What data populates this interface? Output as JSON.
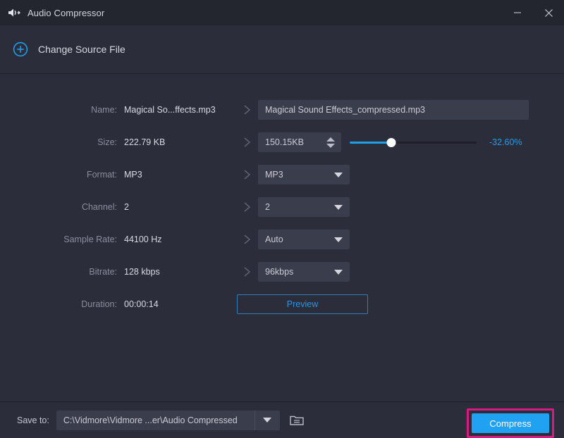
{
  "window": {
    "title": "Audio Compressor",
    "app_icon": "speaker-icon",
    "minimize_label": "—",
    "close_label": "✕"
  },
  "source_bar": {
    "icon": "plus-circle-icon",
    "label": "Change Source File"
  },
  "form": {
    "rows": [
      {
        "label": "Name:",
        "source_value": "Magical So...ffects.mp3",
        "arrow": "chevron-right-icon",
        "field_type": "text",
        "field_value": "Magical Sound Effects_compressed.mp3"
      },
      {
        "label": "Size:",
        "source_value": "222.79 KB",
        "arrow": "chevron-right-icon",
        "field_type": "spinner_slider",
        "field_value": "150.15KB",
        "slider_percent": 33,
        "percent_label": "-32.60%"
      },
      {
        "label": "Format:",
        "source_value": "MP3",
        "arrow": "chevron-right-icon",
        "field_type": "select",
        "field_value": "MP3"
      },
      {
        "label": "Channel:",
        "source_value": "2",
        "arrow": "chevron-right-icon",
        "field_type": "select",
        "field_value": "2"
      },
      {
        "label": "Sample Rate:",
        "source_value": "44100 Hz",
        "arrow": "chevron-right-icon",
        "field_type": "select",
        "field_value": "Auto"
      },
      {
        "label": "Bitrate:",
        "source_value": "128 kbps",
        "arrow": "chevron-right-icon",
        "field_type": "select",
        "field_value": "96kbps"
      },
      {
        "label": "Duration:",
        "source_value": "00:00:14",
        "arrow": "",
        "field_type": "button",
        "field_value": "Preview"
      }
    ]
  },
  "bottom": {
    "save_to_label": "Save to:",
    "path_value": "C:\\Vidmore\\Vidmore ...er\\Audio Compressed",
    "dropdown_icon": "chevron-down-icon",
    "folder_icon": "folder-icon",
    "compress_label": "Compress"
  },
  "colors": {
    "window_bg": "#2b2d3a",
    "titlebar_bg": "#24262f",
    "field_bg": "#3a3d4c",
    "accent_blue": "#1e9fe8",
    "button_blue": "#21a1f1",
    "highlight_pink": "#d81b83",
    "label_gray": "#8a8d9c",
    "text_light": "#d7d9e0"
  }
}
